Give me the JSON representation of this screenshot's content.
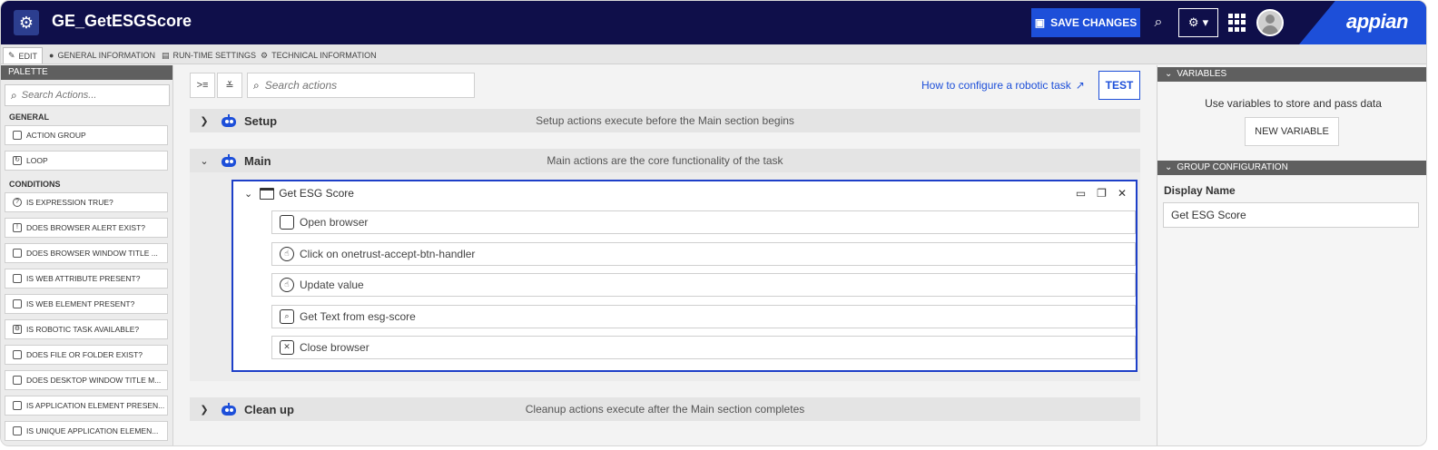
{
  "header": {
    "title": "GE_GetESGScore",
    "save_label": "SAVE CHANGES",
    "logo": "appian"
  },
  "tabs": [
    {
      "label": "EDIT"
    },
    {
      "label": "GENERAL INFORMATION"
    },
    {
      "label": "RUN-TIME SETTINGS"
    },
    {
      "label": "TECHNICAL INFORMATION"
    }
  ],
  "palette": {
    "title": "PALETTE",
    "search_placeholder": "Search Actions...",
    "general_label": "GENERAL",
    "general_items": [
      "ACTION GROUP",
      "LOOP"
    ],
    "conditions_label": "CONDITIONS",
    "condition_items": [
      "IS EXPRESSION TRUE?",
      "DOES BROWSER ALERT EXIST?",
      "DOES BROWSER WINDOW TITLE ...",
      "IS WEB ATTRIBUTE PRESENT?",
      "IS WEB ELEMENT PRESENT?",
      "IS ROBOTIC TASK AVAILABLE?",
      "DOES FILE OR FOLDER EXIST?",
      "DOES DESKTOP WINDOW TITLE M...",
      "IS APPLICATION ELEMENT PRESEN...",
      "IS UNIQUE APPLICATION ELEMEN..."
    ]
  },
  "canvas": {
    "search_placeholder": "Search actions",
    "help_link": "How to configure a robotic task",
    "test_label": "TEST",
    "sections": {
      "setup": {
        "name": "Setup",
        "desc": "Setup actions execute before the Main section begins"
      },
      "main": {
        "name": "Main",
        "desc": "Main actions are the core functionality of the task"
      },
      "cleanup": {
        "name": "Clean up",
        "desc": "Cleanup actions execute after the Main section completes"
      }
    },
    "group": {
      "title": "Get ESG Score",
      "actions": [
        "Open browser",
        "Click on onetrust-accept-btn-handler",
        "Update value",
        "Get Text from esg-score",
        "Close browser"
      ]
    }
  },
  "right_panel": {
    "variables_title": "VARIABLES",
    "variables_hint": "Use variables to store and pass data",
    "new_variable_label": "NEW VARIABLE",
    "group_config_title": "GROUP CONFIGURATION",
    "display_name_label": "Display Name",
    "display_name_value": "Get ESG Score"
  }
}
